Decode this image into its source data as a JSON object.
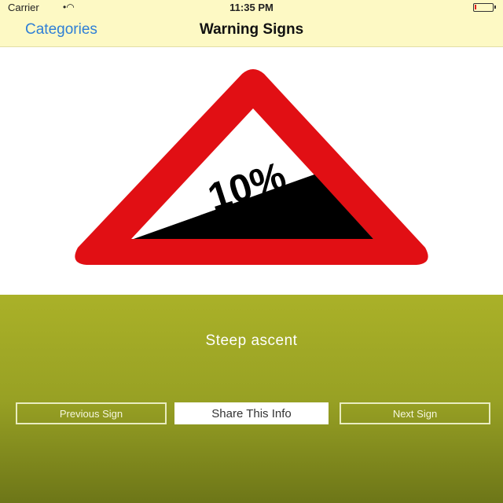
{
  "status_bar": {
    "carrier": "Carrier",
    "wifi_icon": "wifi-icon",
    "time": "11:35 PM",
    "battery_icon": "battery-icon",
    "battery_level": 0.1,
    "battery_color": "#e02020"
  },
  "nav": {
    "back_label": "Categories",
    "title": "Warning Signs"
  },
  "sign": {
    "icon": "steep-ascent-warning-sign",
    "text": "10%",
    "border_color": "#e10f14",
    "fill_color": "#000000"
  },
  "detail": {
    "sign_name": "Steep ascent"
  },
  "buttons": {
    "previous": "Previous Sign",
    "share": "Share This Info",
    "next": "Next Sign"
  }
}
